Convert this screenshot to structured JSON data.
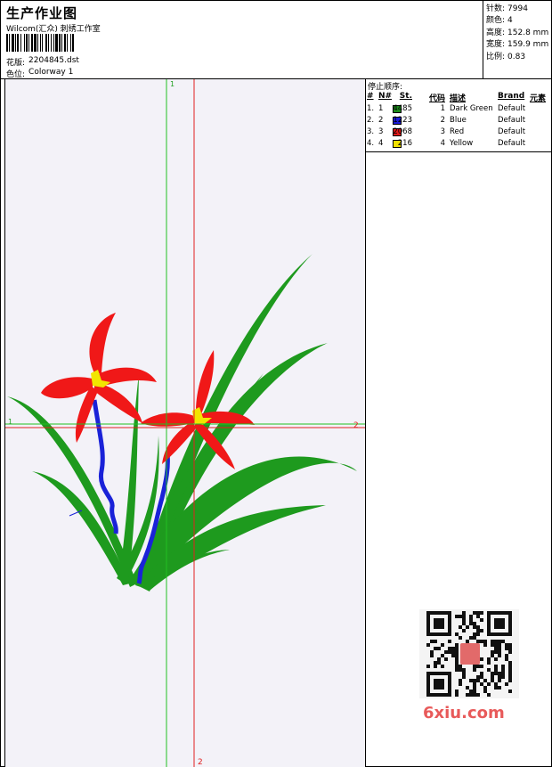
{
  "header": {
    "title": "生产作业图",
    "company": "Wilcom(汇众) 刺绣工作室",
    "design_label": "花版:",
    "design_value": "2204845.dst",
    "colorway_label": "色位:",
    "colorway_value": "Colorway 1"
  },
  "stats": {
    "stitches_label": "针数:",
    "stitches_value": "7994",
    "colors_label": "颜色:",
    "colors_value": "4",
    "height_label": "高度:",
    "height_value": "152.8 mm",
    "width_label": "宽度:",
    "width_value": "159.9 mm",
    "scale_label": "比例:",
    "scale_value": "0.83"
  },
  "canvas": {
    "axis_v_top": "1",
    "axis_h_left": "1",
    "axis_h_right": "2",
    "axis_v_bottom": "2",
    "colors": {
      "background": "#f3f2f8",
      "green_axis": "#22c022",
      "red_axis": "#e02020"
    }
  },
  "stop_sequence": {
    "title": "停止顺序:",
    "columns": {
      "num": "#",
      "n": "N#",
      "stitches": "St.",
      "code": "代码",
      "description": "描述",
      "brand": "Brand",
      "element": "元素"
    },
    "rows": [
      {
        "num": "1.",
        "n": "1",
        "color": "#1a8a1a",
        "stitches": "4485",
        "code": "1",
        "description": "Dark Green",
        "brand": "Default"
      },
      {
        "num": "2.",
        "n": "2",
        "color": "#1a1ad8",
        "stitches": "1223",
        "code": "2",
        "description": "Blue",
        "brand": "Default"
      },
      {
        "num": "3.",
        "n": "3",
        "color": "#e01818",
        "stitches": "2068",
        "code": "3",
        "description": "Red",
        "brand": "Default"
      },
      {
        "num": "4.",
        "n": "4",
        "color": "#f0e000",
        "stitches": "216",
        "code": "4",
        "description": "Yellow",
        "brand": "Default"
      }
    ]
  },
  "embroidery_colors": {
    "leaf": "#1e9a1e",
    "stem": "#1a22d8",
    "petal": "#f01818",
    "stamen": "#f2e600"
  },
  "watermark": {
    "text": "6xiu.com"
  }
}
